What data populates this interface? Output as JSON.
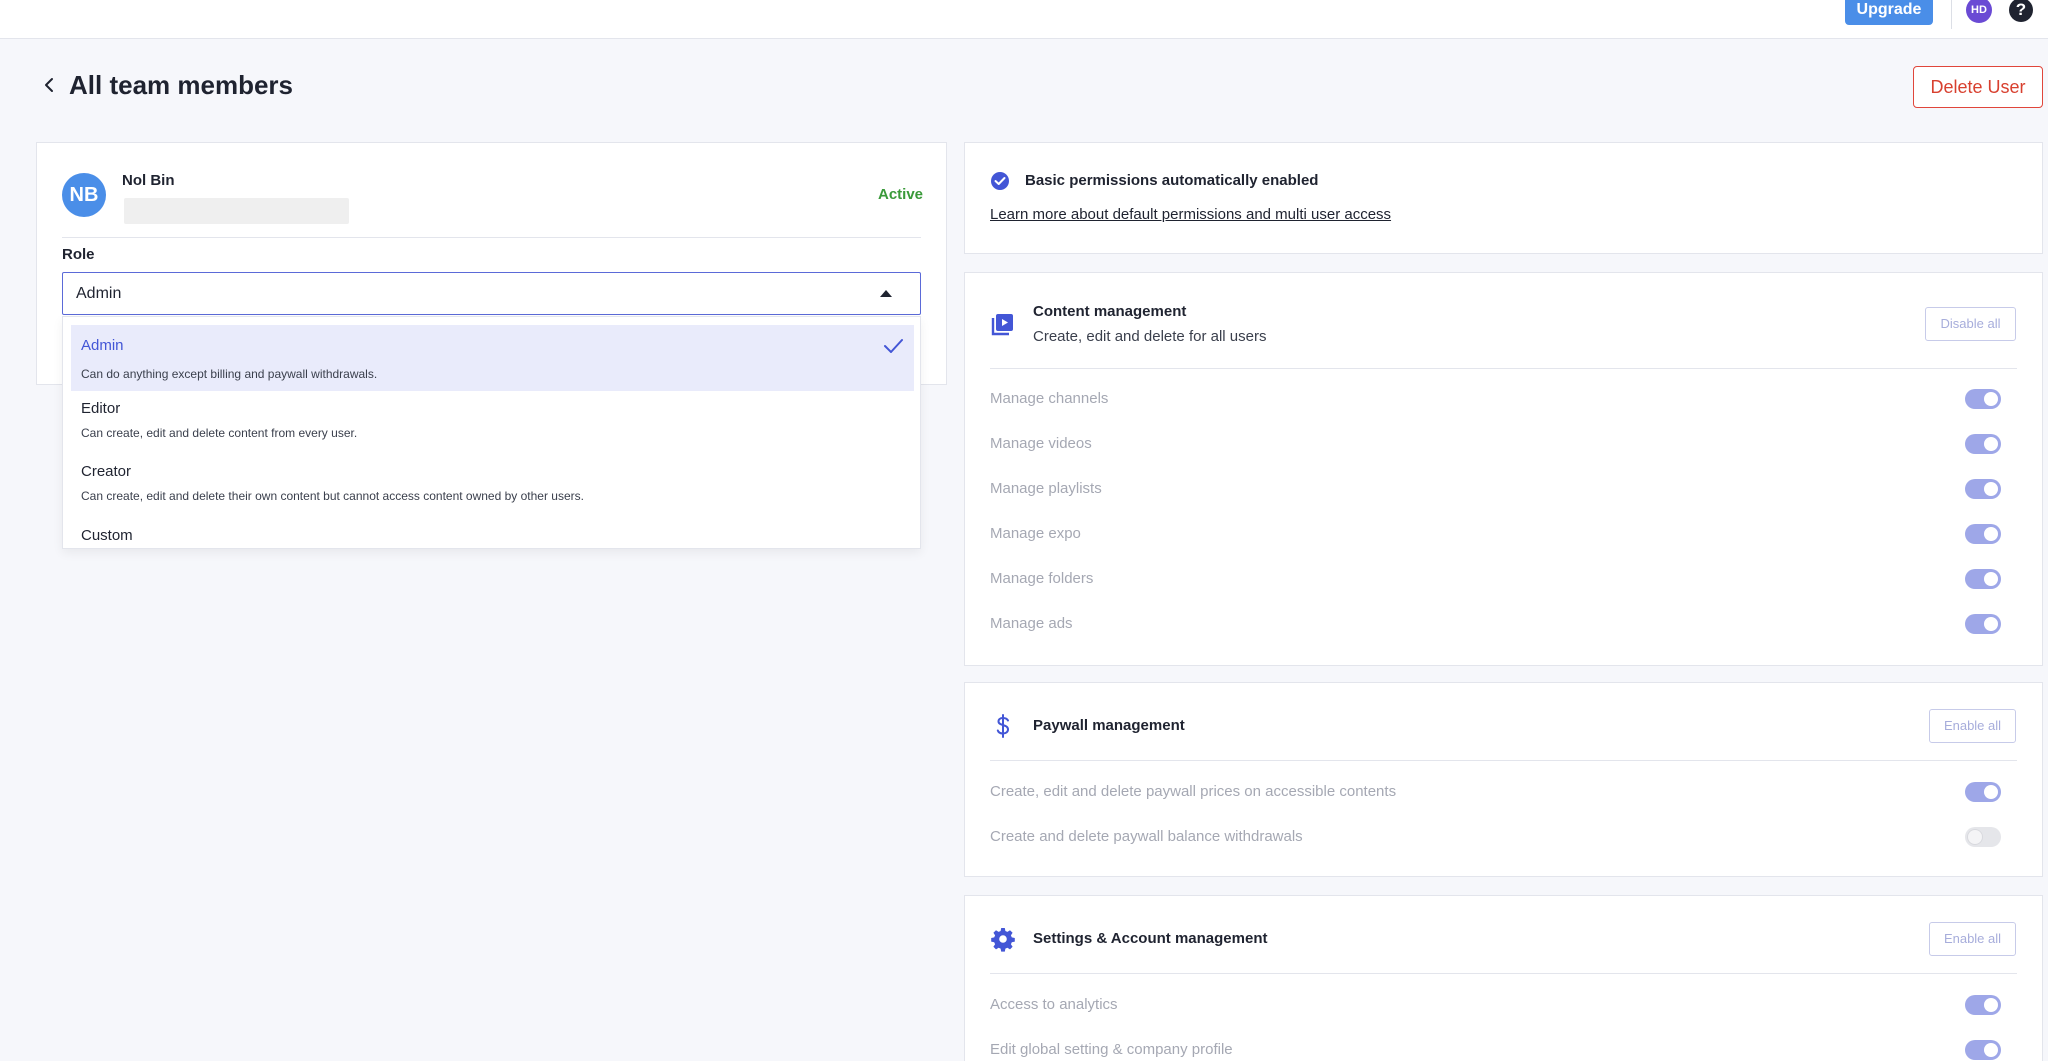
{
  "topbar": {
    "upgrade_label": "Upgrade",
    "user_initials": "HD",
    "help_label": "?"
  },
  "header": {
    "title": "All team members",
    "delete_label": "Delete User"
  },
  "user": {
    "initials": "NB",
    "name": "Nol Bin",
    "status": "Active",
    "role_label": "Role",
    "role_value": "Admin"
  },
  "roles": [
    {
      "title": "Admin",
      "desc": "Can do anything except billing and paywall withdrawals.",
      "selected": true
    },
    {
      "title": "Editor",
      "desc": "Can create, edit and delete content from every user."
    },
    {
      "title": "Creator",
      "desc": "Can create, edit and delete their own content but cannot access content owned by other users."
    },
    {
      "title": "Custom",
      "desc": ""
    }
  ],
  "basic": {
    "title": "Basic permissions automatically enabled",
    "link": "Learn more about default permissions and multi user access"
  },
  "content_mgmt": {
    "title": "Content management",
    "subtitle": "Create, edit and delete for all users",
    "button": "Disable all",
    "items": [
      {
        "label": "Manage channels",
        "on": true
      },
      {
        "label": "Manage videos",
        "on": true
      },
      {
        "label": "Manage playlists",
        "on": true
      },
      {
        "label": "Manage expo",
        "on": true
      },
      {
        "label": "Manage folders",
        "on": true
      },
      {
        "label": "Manage ads",
        "on": true
      }
    ]
  },
  "paywall_mgmt": {
    "title": "Paywall management",
    "button": "Enable all",
    "items": [
      {
        "label": "Create, edit and delete paywall prices on accessible contents",
        "on": true
      },
      {
        "label": "Create and delete paywall balance withdrawals",
        "on": false
      }
    ]
  },
  "settings_mgmt": {
    "title": "Settings & Account management",
    "button": "Enable all",
    "items": [
      {
        "label": "Access to analytics",
        "on": true
      },
      {
        "label": "Edit global setting & company profile",
        "on": true
      }
    ]
  },
  "colors": {
    "accent": "#4356d6",
    "upgrade": "#4a8ee8",
    "active": "#3a9a3a",
    "danger": "#d8402f",
    "toggle_on": "#9ea7e8"
  },
  "icons": {
    "back": "chevron-left-icon",
    "check": "checkmark-icon",
    "basic": "check-circle-icon",
    "content": "video-library-icon",
    "paywall": "dollar-icon",
    "settings": "gear-icon"
  }
}
